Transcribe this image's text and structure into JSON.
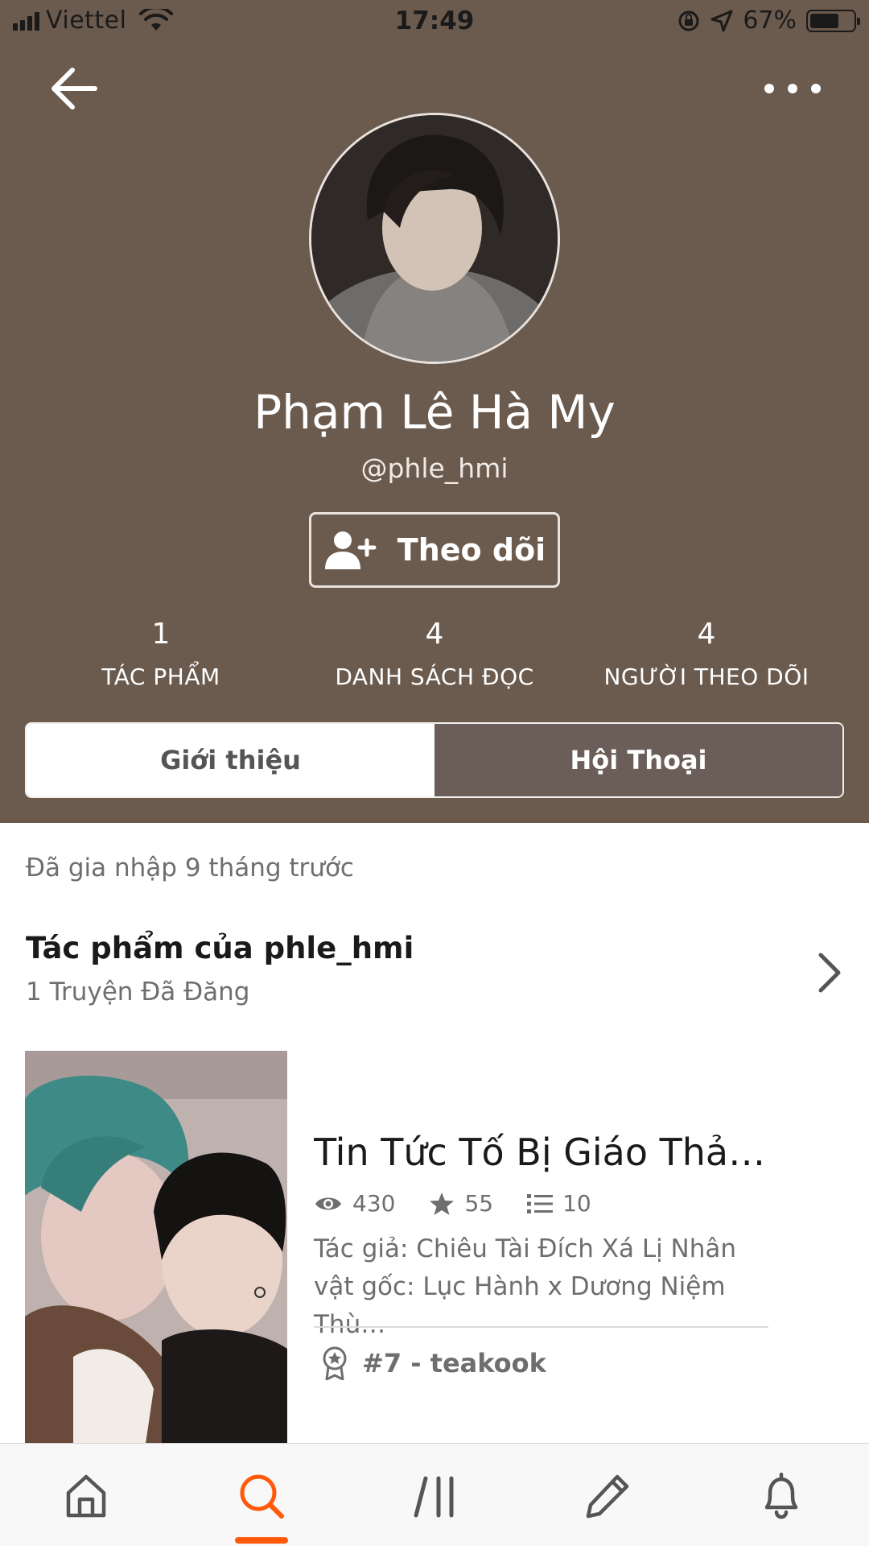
{
  "status_bar": {
    "carrier": "Viettel",
    "time": "17:49",
    "battery": "67%",
    "battery_level": 0.67
  },
  "profile": {
    "name": "Phạm Lê Hà My",
    "handle": "@phle_hmi",
    "follow_label": "Theo dõi"
  },
  "stats": [
    {
      "value": "1",
      "label": "TÁC PHẨM"
    },
    {
      "value": "4",
      "label": "DANH SÁCH ĐỌC"
    },
    {
      "value": "4",
      "label": "NGƯỜI THEO DÕI"
    }
  ],
  "tabs": {
    "intro": "Giới thiệu",
    "conversation": "Hội Thoại",
    "active": "conversation"
  },
  "about": {
    "joined": "Đã gia nhập 9 tháng trước"
  },
  "works": {
    "title": "Tác phẩm của phle_hmi",
    "count_label": "1 Truyện Đã Đăng"
  },
  "story": {
    "title": "Tin Tức Tố Bị Giáo Thảo…",
    "views": "430",
    "votes": "55",
    "parts": "10",
    "description": "Tác giả: Chiêu Tài Đích Xá Lị Nhân vật gốc: Lục Hành x Dương Niệm Thù…",
    "tag": "#7 - teakook"
  },
  "bottom_nav": {
    "items": [
      "home-icon",
      "search-icon",
      "library-icon",
      "write-icon",
      "notifications-icon"
    ],
    "active": "search-icon"
  },
  "colors": {
    "header_bg": "#6b5a4e",
    "active_tab_bg": "#6b5e58",
    "accent": "#ff5a0a"
  }
}
